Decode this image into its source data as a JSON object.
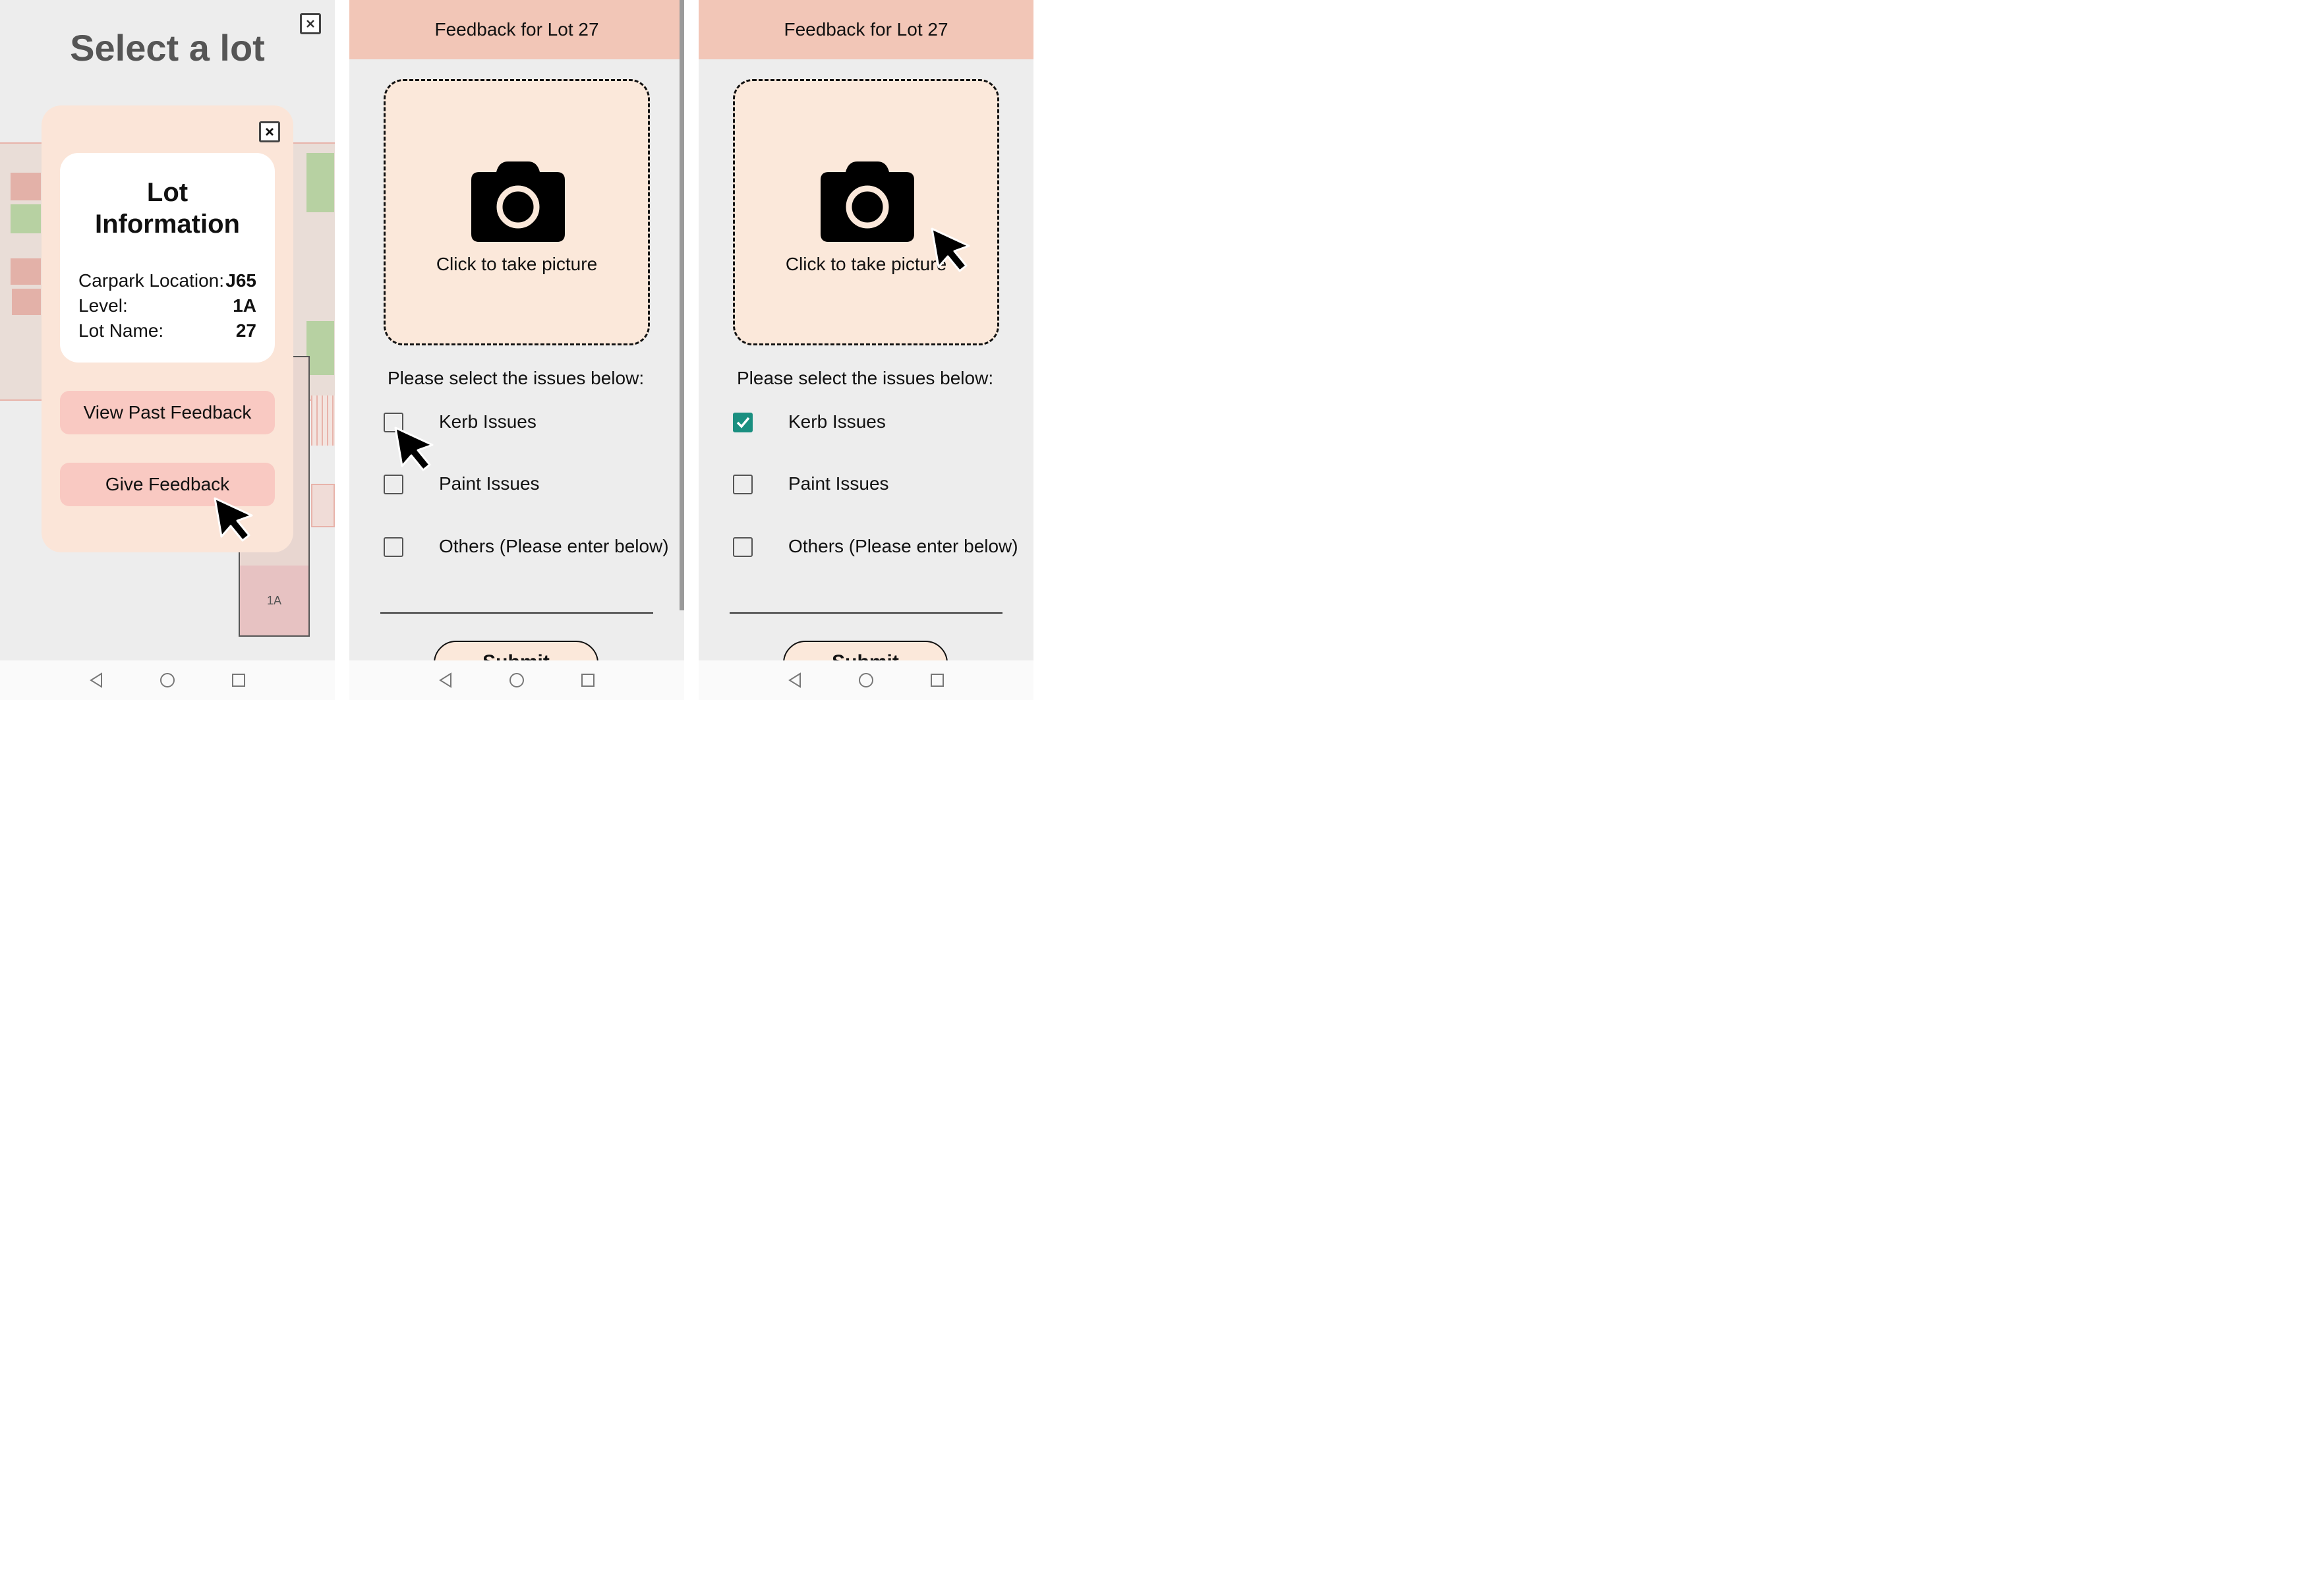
{
  "screen1": {
    "title": "Select a lot",
    "lot_info": {
      "title_line1": "Lot",
      "title_line2": "Information",
      "rows": [
        {
          "label": "Carpark Location:",
          "value": "J65"
        },
        {
          "label": "Level:",
          "value": "1A"
        },
        {
          "label": "Lot Name:",
          "value": "27"
        }
      ]
    },
    "view_past_feedback_label": "View Past Feedback",
    "give_feedback_label": "Give Feedback",
    "map_lot_label": "1A",
    "colors": {
      "modal_bg": "#fbe5d8",
      "button_bg": "#f9c9c2",
      "lot_red": "#e3b1a8",
      "lot_green": "#b7d1a2"
    }
  },
  "screen2": {
    "header": "Feedback for Lot 27",
    "photo_label": "Click to take picture",
    "prompt": "Please select the issues below:",
    "issues": [
      {
        "label": "Kerb Issues",
        "checked": false
      },
      {
        "label": "Paint Issues",
        "checked": false
      },
      {
        "label": "Others (Please enter below)",
        "checked": false
      }
    ],
    "submit_label": "Submit"
  },
  "screen3": {
    "header": "Feedback for Lot 27",
    "photo_label": "Click to take picture",
    "prompt": "Please select the issues below:",
    "issues": [
      {
        "label": "Kerb Issues",
        "checked": true
      },
      {
        "label": "Paint Issues",
        "checked": false
      },
      {
        "label": "Others (Please enter below)",
        "checked": false
      }
    ],
    "submit_label": "Submit"
  },
  "navbar": {
    "buttons": [
      "back-icon",
      "home-icon",
      "recents-icon"
    ]
  },
  "colors": {
    "header_bg": "#f2c6b7",
    "photo_bg": "#fbe8da",
    "check_color": "#1a8f80"
  }
}
